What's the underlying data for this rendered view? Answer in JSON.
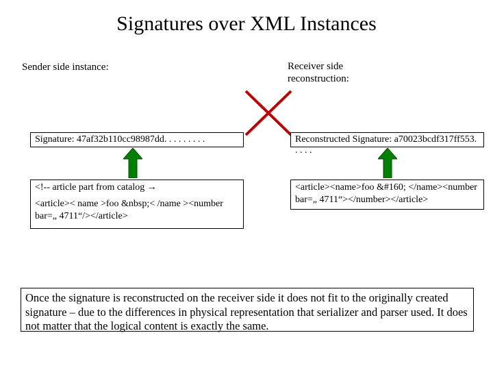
{
  "title": "Signatures over XML Instances",
  "sender_label": "Sender side instance:",
  "receiver_label": "Receiver side reconstruction:",
  "signature_box": "Signature: 47af32b110cc98987dd. . . . . . . . .",
  "reconstructed_box": "Reconstructed Signature: a70023bcdf317ff553. . . . .",
  "left_xml_line1": "<!-- article part from catalog →",
  "left_xml_line2": "<article>< name >foo &nbsp;< /name ><number bar=„ 4711“/></article>",
  "right_xml": "<article><name>foo &#160; </name><number bar=„ 4711“></number></article>",
  "explanation": "Once the signature is reconstructed on the receiver side it does not fit to the originally created signature – due to the differences in physical representation that serializer and parser used. It does not matter that the logical content is exactly the same.",
  "colors": {
    "cross_stroke": "#c00000",
    "arrow_fill": "#008000",
    "arrow_stroke": "#004d00"
  }
}
